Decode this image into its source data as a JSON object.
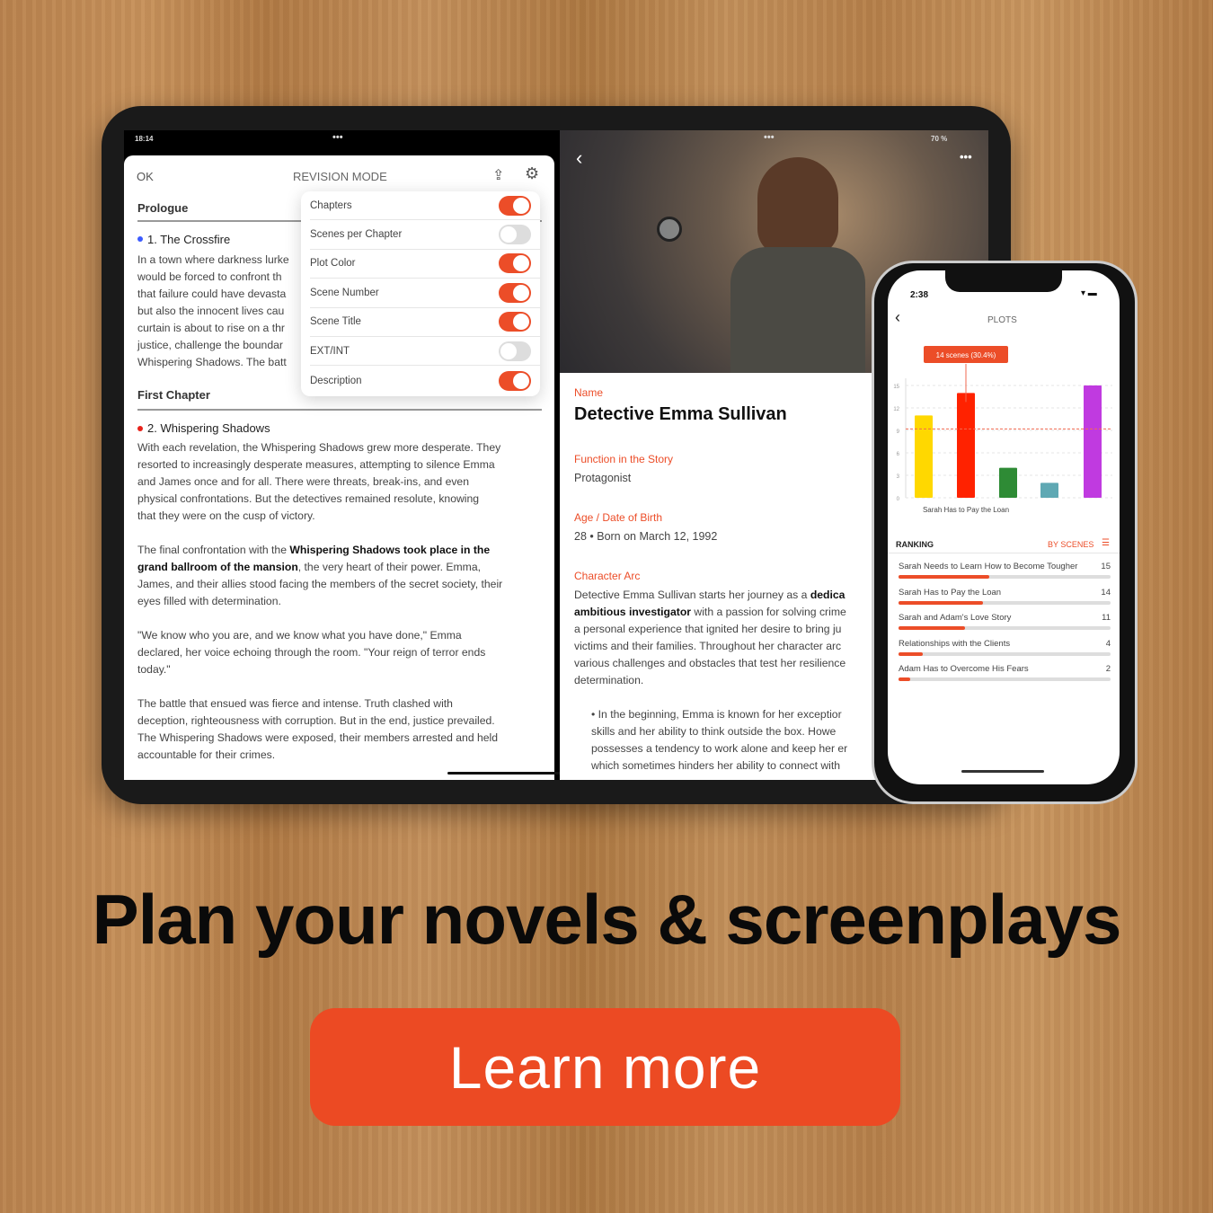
{
  "tablet": {
    "status_time": "18:14",
    "status_battery": "70 %",
    "left": {
      "ok_label": "OK",
      "title": "REVISION MODE",
      "prologue": "Prologue",
      "scene1": {
        "title": "1. The Crossfire",
        "dot_color": "#3b5bff",
        "lines": [
          "In a town where darkness lurke",
          "would be forced to confront th",
          "that failure could have devasta",
          "but also the innocent lives cau",
          "curtain is about to rise on a thr",
          "justice, challenge the boundar",
          "Whispering Shadows. The batt"
        ]
      },
      "first_chapter": "First Chapter",
      "scene2": {
        "title": "2. Whispering Shadows",
        "dot_color": "#e8221a",
        "p1": [
          "With each revelation, the Whispering Shadows grew more desperate. They",
          "resorted to increasingly desperate measures, attempting to silence Emma",
          "and James once and for all. There were threats, break-ins, and even",
          "physical confrontations. But the detectives remained resolute, knowing",
          "that they were on the cusp of victory."
        ],
        "p2_l1a": "The final confrontation with the ",
        "p2_l1b": "Whispering Shadows took place in the",
        "p2_l2a": "grand ballroom of the mansion",
        "p2_l2b": ", the very heart of their power. Emma,",
        "p2_rest": [
          "James, and their allies stood facing the members of the secret society, their",
          "eyes filled with determination."
        ],
        "p3": [
          "\"We know who you are, and we know what you have done,\" Emma",
          "declared, her voice echoing through the room. \"Your reign of terror ends",
          "today.\""
        ],
        "p4": [
          "The battle that ensued was fierce and intense. Truth clashed with",
          "deception, righteousness with corruption. But in the end, justice prevailed.",
          "The Whispering Shadows were exposed, their members arrested and held",
          "accountable for their crimes."
        ]
      },
      "settings": [
        {
          "label": "Chapters",
          "on": true
        },
        {
          "label": "Scenes per Chapter",
          "on": false
        },
        {
          "label": "Plot Color",
          "on": true
        },
        {
          "label": "Scene Number",
          "on": true
        },
        {
          "label": "Scene Title",
          "on": true
        },
        {
          "label": "EXT/INT",
          "on": false
        },
        {
          "label": "Description",
          "on": true
        }
      ]
    },
    "right": {
      "name_label": "Name",
      "name": "Detective Emma Sullivan",
      "function_label": "Function in the Story",
      "function": "Protagonist",
      "age_label": "Age / Date of Birth",
      "age": "28 • Born on March 12, 1992",
      "arc_label": "Character Arc",
      "arc_l1a": "Detective Emma Sullivan starts her journey as a ",
      "arc_l1b": "dedica",
      "arc_l2a": "ambitious investigator",
      "arc_l2b": " with a passion for solving crime",
      "arc_rest": [
        "a personal experience that ignited her desire to bring ju",
        "victims and their families. Throughout her character arc",
        "various challenges and obstacles that test her resilience",
        "determination."
      ],
      "bullet": [
        "• In the beginning, Emma is known for her exceptior",
        "skills and her ability to think   outside the box. Howe",
        "possesses a tendency to work alone and keep her er",
        "which sometimes hinders her ability to connect with"
      ]
    }
  },
  "phone": {
    "time": "2:38",
    "title": "PLOTS",
    "tooltip": "14 scenes (30.4%)",
    "ranking_label": "RANKING",
    "sort_label": "BY SCENES",
    "ranking": [
      {
        "name": "Sarah Needs to Learn How to Become Tougher",
        "count": "15"
      },
      {
        "name": "Sarah Has to Pay the Loan",
        "count": "14"
      },
      {
        "name": "Sarah and Adam's Love Story",
        "count": "11"
      },
      {
        "name": "Relationships with the Clients",
        "count": "4"
      },
      {
        "name": "Adam Has to Overcome His Fears",
        "count": "2"
      }
    ]
  },
  "chart_data": {
    "type": "bar",
    "categories": [
      "Sarah and Adam's Love Story",
      "Sarah Has to Pay the Loan",
      "Relationships with the Clients",
      "Adam Has to Overcome His Fears",
      "Sarah Needs to Learn How to Become Tougher"
    ],
    "values": [
      11,
      14,
      4,
      2,
      15
    ],
    "colors": [
      "#ffd800",
      "#ff2200",
      "#2e8b35",
      "#5fa8b3",
      "#c03ae0"
    ],
    "selected_label": "Sarah Has to Pay the Loan",
    "yticks": [
      "0",
      "3",
      "6",
      "9",
      "12",
      "15"
    ],
    "ylim": [
      0,
      15
    ],
    "average": 9.2,
    "grid": true
  },
  "headline": "Plan your novels & screenplays",
  "cta": "Learn more"
}
